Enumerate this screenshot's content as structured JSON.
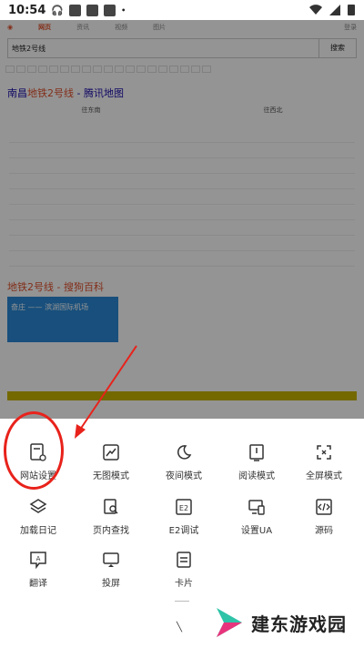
{
  "status_bar": {
    "time": "10:54"
  },
  "background_page": {
    "top_tabs": [
      "网页",
      "资讯",
      "视频",
      "图片"
    ],
    "top_tab_right": "登录",
    "search_query": "地铁2号线",
    "search_button": "搜索",
    "result_title_highlight": "地铁2号线",
    "result_title_prefix": "南昌",
    "result_title_suffix": " - 腾讯地图",
    "map_tabs": [
      "往东南",
      "往西北"
    ],
    "section2_title": "地铁2号线 - 搜狗百科",
    "banner_text": "奋庄 —— 滨湖国际机场"
  },
  "sheet": {
    "items": [
      {
        "id": "site-settings",
        "label": "网站设置",
        "icon": "site-settings-icon"
      },
      {
        "id": "no-image",
        "label": "无图模式",
        "icon": "no-image-icon"
      },
      {
        "id": "night",
        "label": "夜间模式",
        "icon": "moon-icon"
      },
      {
        "id": "reading",
        "label": "阅读模式",
        "icon": "book-icon"
      },
      {
        "id": "fullscreen",
        "label": "全屏模式",
        "icon": "fullscreen-icon"
      },
      {
        "id": "load-log",
        "label": "加载日记",
        "icon": "layers-icon"
      },
      {
        "id": "find-in-page",
        "label": "页内查找",
        "icon": "find-icon"
      },
      {
        "id": "e2-debug",
        "label": "E2调试",
        "icon": "e2-icon"
      },
      {
        "id": "set-ua",
        "label": "设置UA",
        "icon": "devices-icon"
      },
      {
        "id": "source",
        "label": "源码",
        "icon": "code-icon"
      },
      {
        "id": "translate",
        "label": "翻译",
        "icon": "translate-icon"
      },
      {
        "id": "cast",
        "label": "投屏",
        "icon": "cast-icon"
      },
      {
        "id": "card",
        "label": "卡片",
        "icon": "card-icon"
      }
    ]
  },
  "watermark": {
    "text": "建东游戏园"
  },
  "colors": {
    "highlight": "#e8221b",
    "overlay": "#000000",
    "accent": "#e0502c"
  }
}
